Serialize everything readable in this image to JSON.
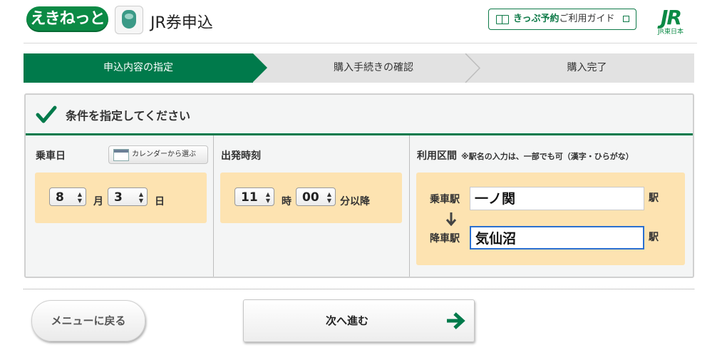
{
  "header": {
    "logo_text": "えきねっと",
    "app_icon": "ticket-machine-icon",
    "title": "JR券申込",
    "guide_strong": "きっぷ予約",
    "guide_rest": "ご利用ガイド",
    "jr_mark": "JR",
    "jr_sub": "JR東日本"
  },
  "steps": [
    {
      "label": "申込内容の指定",
      "active": true
    },
    {
      "label": "購入手続きの確認",
      "active": false
    },
    {
      "label": "購入完了",
      "active": false
    }
  ],
  "panel": {
    "title": "条件を指定してください",
    "date": {
      "label": "乗車日",
      "calendar_button": "カレンダーから選ぶ",
      "month": "8",
      "month_unit": "月",
      "day": "3",
      "day_unit": "日"
    },
    "time": {
      "label": "出発時刻",
      "hour": "11",
      "hour_unit": "時",
      "minute": "00",
      "minute_unit": "分以降"
    },
    "section": {
      "label": "利用区間",
      "note": "※駅名の入力は、一部でも可（漢字・ひらがな）",
      "board_label": "乗車駅",
      "board_value": "一ノ関",
      "alight_label": "降車駅",
      "alight_value": "気仙沼",
      "station_suffix": "駅"
    }
  },
  "buttons": {
    "back": "メニューに戻る",
    "next": "次へ進む"
  },
  "colors": {
    "brand_green": "#007a4b",
    "field_bg": "#fde3b1"
  }
}
